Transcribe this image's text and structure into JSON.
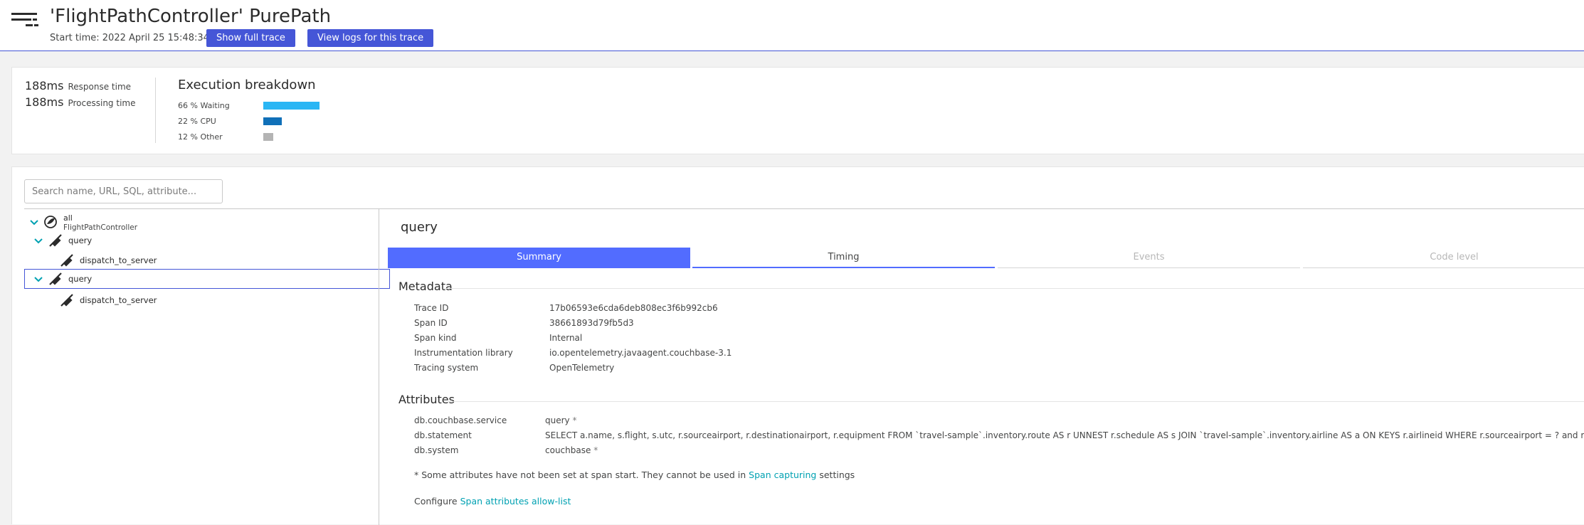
{
  "header": {
    "title": "'FlightPathController' PurePath",
    "start_time": "Start time: 2022 April 25 15:48:34",
    "show_full_trace": "Show full trace",
    "view_logs": "View logs for this trace"
  },
  "summary": {
    "response_time_value": "188ms",
    "response_time_label": "Response time",
    "processing_time_value": "188ms",
    "processing_time_label": "Processing time",
    "execution_title": "Execution breakdown",
    "breakdown": [
      {
        "label": "66 % Waiting",
        "percent": 66,
        "color": "#2ab6f4"
      },
      {
        "label": "22 % CPU",
        "percent": 22,
        "color": "#1070b8"
      },
      {
        "label": "12 % Other",
        "percent": 12,
        "color": "#b4b4b4"
      }
    ]
  },
  "search": {
    "placeholder": "Search name, URL, SQL, attribute..."
  },
  "tree": {
    "root_label": "all",
    "root_sub": "FlightPathController",
    "nodes": [
      {
        "label": "query"
      },
      {
        "label": "dispatch_to_server"
      },
      {
        "label": "query"
      },
      {
        "label": "dispatch_to_server"
      }
    ]
  },
  "detail": {
    "title": "query",
    "tabs": [
      {
        "label": "Summary"
      },
      {
        "label": "Timing"
      },
      {
        "label": "Events"
      },
      {
        "label": "Code level"
      }
    ],
    "metadata_title": "Metadata",
    "metadata": [
      {
        "key": "Trace ID",
        "value": "17b06593e6cda6deb808ec3f6b992cb6"
      },
      {
        "key": "Span ID",
        "value": "38661893d79fb5d3"
      },
      {
        "key": "Span kind",
        "value": "Internal"
      },
      {
        "key": "Instrumentation library",
        "value": "io.opentelemetry.javaagent.couchbase-3.1"
      },
      {
        "key": "Tracing system",
        "value": "OpenTelemetry"
      }
    ],
    "attributes_title": "Attributes",
    "attributes": [
      {
        "key": "db.couchbase.service",
        "value": "query",
        "star": "*"
      },
      {
        "key": "db.statement",
        "value": "SELECT a.name, s.flight, s.utc, r.sourceairport, r.destinationairport, r.equipment FROM `travel-sample`.inventory.route AS r UNNEST r.schedule AS s JOIN `travel-sample`.inventory.airline AS a ON KEYS r.airlineid WHERE r.sourceairport = ? and r.destin",
        "star": "*"
      },
      {
        "key": "db.system",
        "value": "couchbase",
        "star": "*"
      }
    ],
    "note_prefix": "* Some attributes have not been set at span start. They cannot be used in",
    "note_link": "Span capturing",
    "note_suffix": "settings",
    "configure_prefix": "Configure",
    "configure_link": "Span attributes allow-list"
  }
}
